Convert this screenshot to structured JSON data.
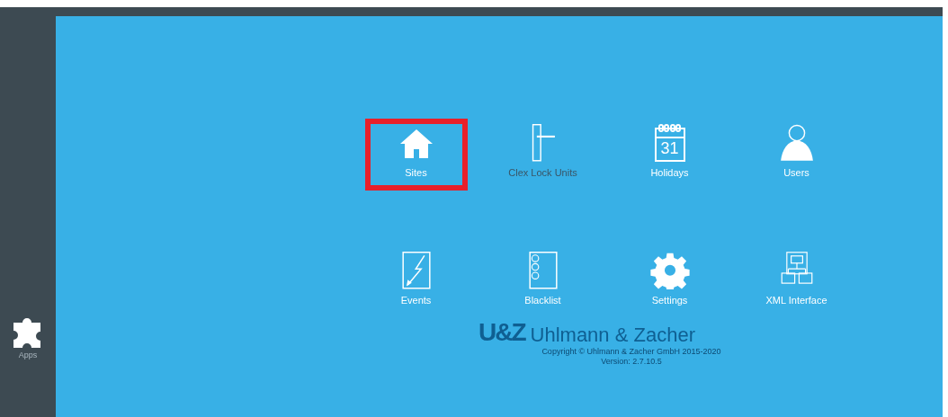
{
  "sidebar": {
    "apps_label": "Apps"
  },
  "tiles": [
    {
      "kind": "house",
      "label": "Sites",
      "highlighted": true,
      "disabled": false
    },
    {
      "kind": "lock",
      "label": "Clex Lock Units",
      "highlighted": false,
      "disabled": true
    },
    {
      "kind": "calendar",
      "label": "Holidays",
      "icon_text": "31",
      "highlighted": false,
      "disabled": false
    },
    {
      "kind": "user",
      "label": "Users",
      "highlighted": false,
      "disabled": false
    },
    {
      "kind": "events",
      "label": "Events",
      "highlighted": false,
      "disabled": false
    },
    {
      "kind": "blacklist",
      "label": "Blacklist",
      "highlighted": false,
      "disabled": false
    },
    {
      "kind": "gear",
      "label": "Settings",
      "highlighted": false,
      "disabled": false
    },
    {
      "kind": "xml",
      "label": "XML Interface",
      "highlighted": false,
      "disabled": false
    }
  ],
  "logo": {
    "mark": "U&Z",
    "name": "Uhlmann & Zacher"
  },
  "footer": {
    "copyright": "Copyright © Uhlmann & Zacher GmbH 2015-2020",
    "version": "Version: 2.7.10.5"
  }
}
